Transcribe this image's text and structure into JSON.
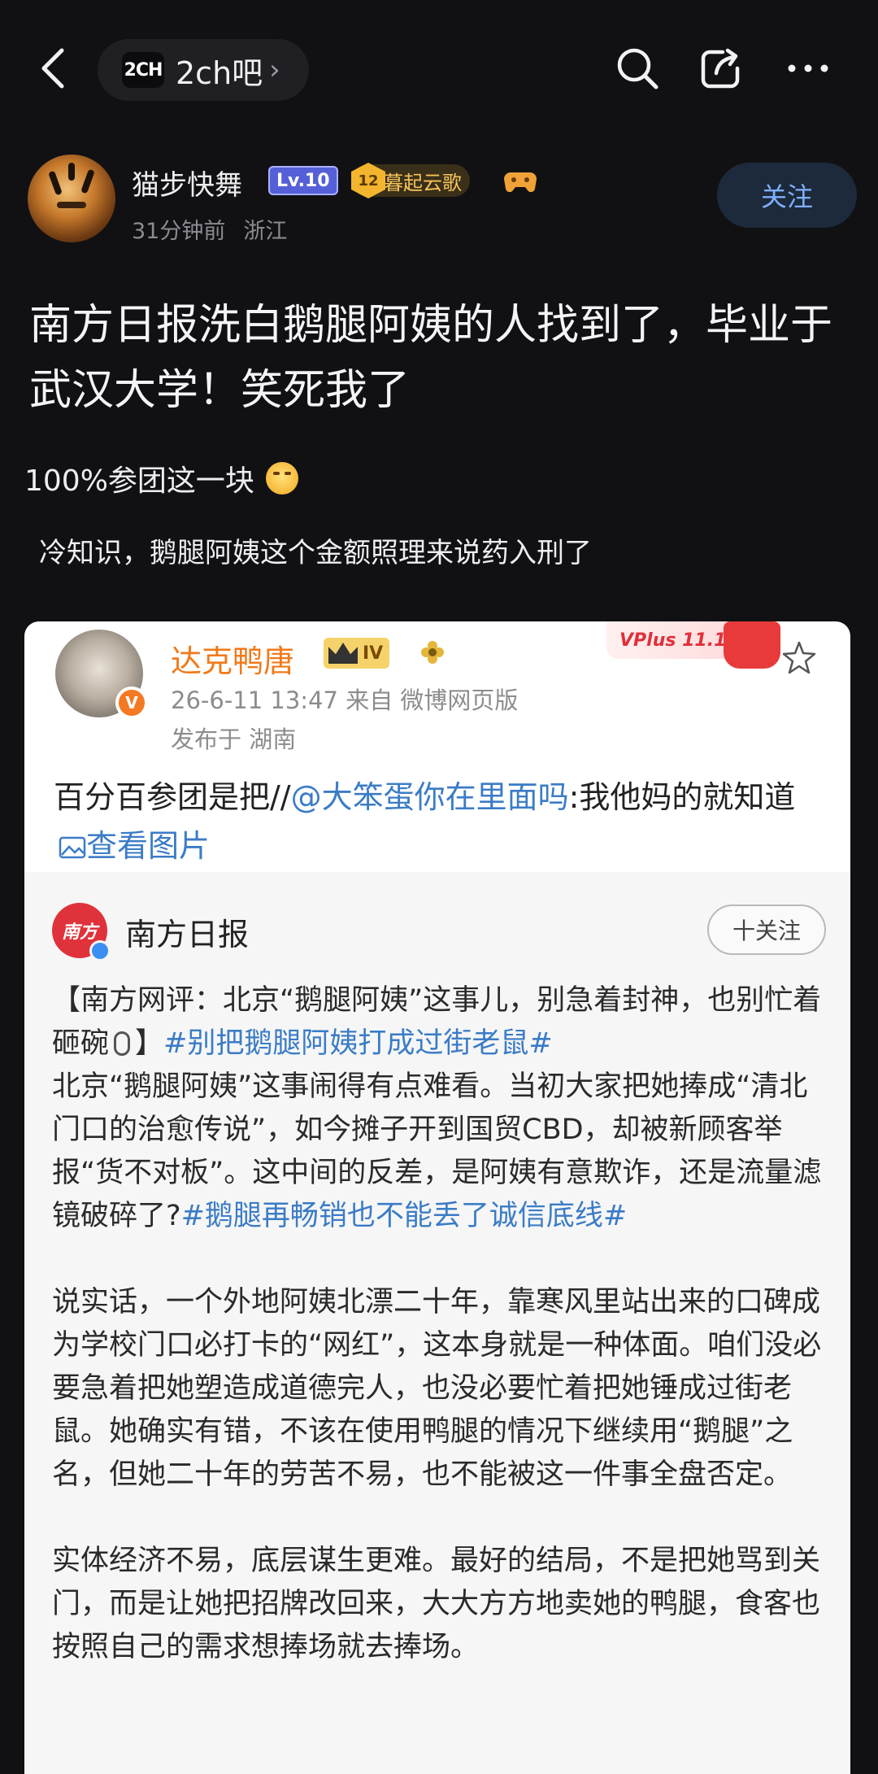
{
  "nav": {
    "forum_logo": "2CH",
    "forum_name": "2ch吧",
    "forum_chevron": "›"
  },
  "author": {
    "name": "猫步快舞",
    "level": "Lv.10",
    "badge_number": "12",
    "badge_title": "暮起云歌",
    "time": "31分钟前",
    "location": "浙江",
    "follow_label": "关注"
  },
  "post": {
    "title": "南方日报洗白鹅腿阿姨的人找到了，毕业于武汉大学！笑死我了",
    "line1": "100%参团这一块",
    "line2": "冷知识，鹅腿阿姨这个金额照理来说药入刑了"
  },
  "weibo": {
    "name": "达克鸭唐",
    "crown_level": "IV",
    "vbadge": "V",
    "time": "26-6-11 13:47  来自 微博网页版",
    "from": "发布于 湖南",
    "vplus": "VPlus 11.11",
    "content_prefix": "百分百参团是把//",
    "content_mention": "@大笨蛋你在里面吗",
    "content_suffix": ":我他妈的就知道",
    "content_imglink": "查看图片",
    "repost": {
      "logo": "南方",
      "name": "南方日报",
      "follow_label": "十关注",
      "p1_text_a": "【南方网评：北京“鹅腿阿姨”这事儿，别急着封神，也别忙着砸碗",
      "p1_text_b": "】",
      "p1_tag1": "#别把鹅腿阿姨打成过街老鼠#",
      "p1_text_c": "北京“鹅腿阿姨”这事闹得有点难看。当初大家把她捧成“清北门口的治愈传说”，如今摊子开到国贸CBD，却被新顾客举报“货不对板”。这中间的反差，是阿姨有意欺诈，还是流量滤镜破碎了?",
      "p1_tag2": "#鹅腿再畅销也不能丢了诚信底线#",
      "p2": "说实话，一个外地阿姨北漂二十年，靠寒风里站出来的口碑成为学校门口必打卡的“网红”，这本身就是一种体面。咱们没必要急着把她塑造成道德完人，也没必要忙着把她锤成过街老鼠。她确实有错，不该在使用鸭腿的情况下继续用“鹅腿”之名，但她二十年的劳苦不易，也不能被这一件事全盘否定。",
      "p3": "实体经济不易，底层谋生更难。最好的结局，不是把她骂到关门，而是让她把招牌改回来，大大方方地卖她的鸭腿，食客也按照自己的需求想捧场就去捧场。"
    }
  },
  "colors": {
    "background": "#111114",
    "accent_blue": "#7fb0ff",
    "weibo_orange": "#f07a1a",
    "link_blue": "#3b7cc6"
  }
}
